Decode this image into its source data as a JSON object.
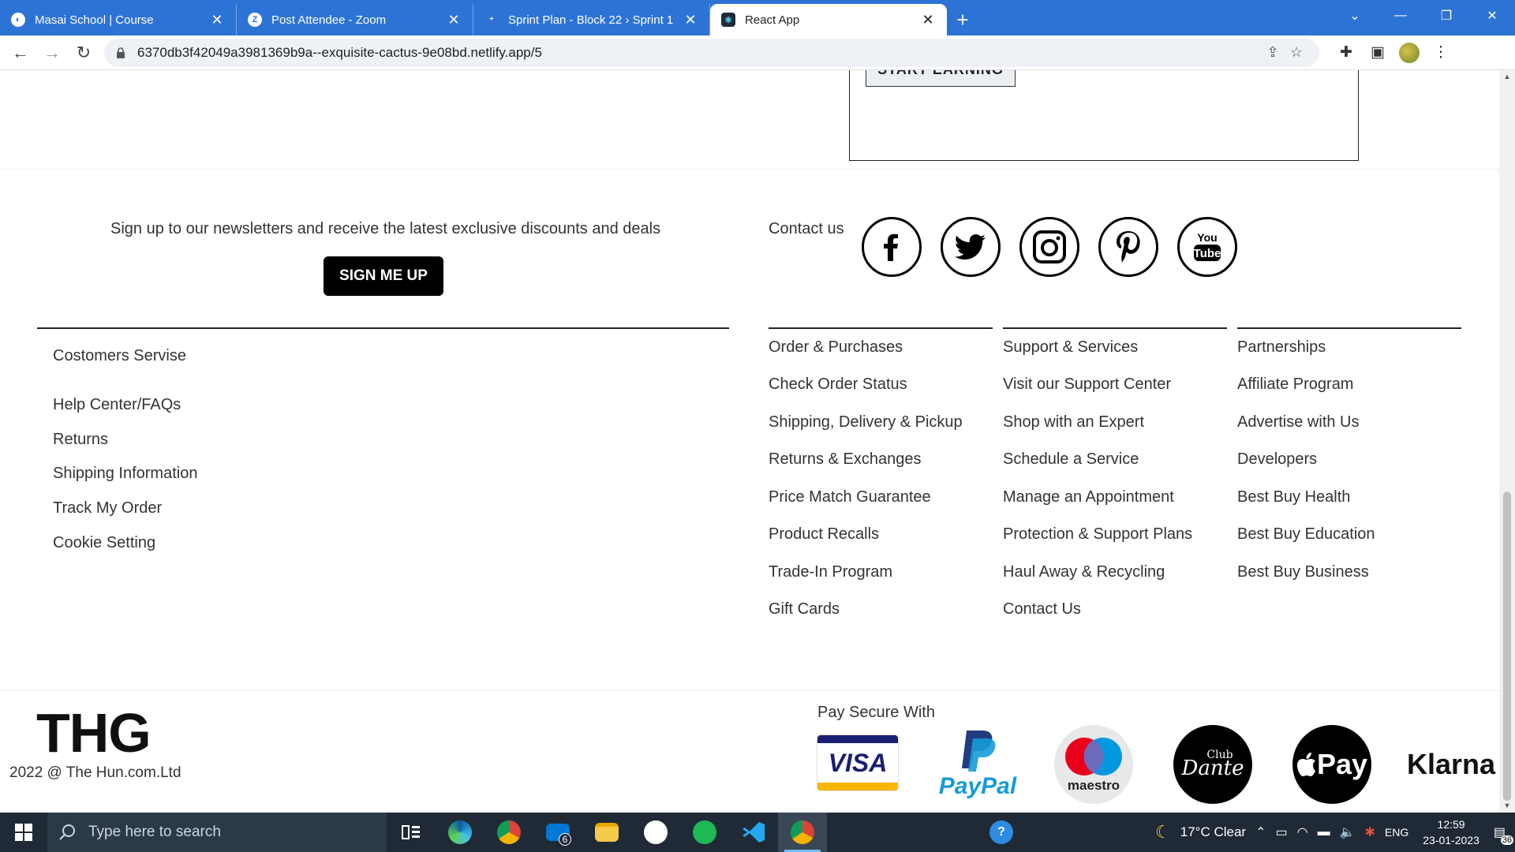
{
  "browser": {
    "tabs": [
      {
        "title": "Masai School | Course",
        "active": false
      },
      {
        "title": "Post Attendee - Zoom",
        "active": false
      },
      {
        "title": "Sprint Plan - Block 22 › Sprint 1",
        "active": false
      },
      {
        "title": "React App",
        "active": true
      }
    ],
    "close_glyph": "✕",
    "new_tab_glyph": "+",
    "url": "6370db3f42049a3981369b9a--exquisite-cactus-9e08bd.netlify.app/5"
  },
  "page": {
    "promo_button": "START EARNING",
    "newsletter": {
      "text": "Sign up to our newsletters and receive the latest exclusive discounts and deals",
      "button": "SIGN ME UP"
    },
    "contact": {
      "label": "Contact us",
      "socials": [
        "facebook-icon",
        "twitter-icon",
        "instagram-icon",
        "pinterest-icon",
        "youtube-icon"
      ]
    },
    "customer_service": {
      "title": "Costomers Servise",
      "links": [
        "Help Center/FAQs",
        "Returns",
        "Shipping Information",
        "Track My Order",
        "Cookie Setting"
      ]
    },
    "columns": [
      {
        "title": "Order & Purchases",
        "links": [
          "Check Order Status",
          "Shipping, Delivery & Pickup",
          "Returns & Exchanges",
          "Price Match Guarantee",
          "Product Recalls",
          "Trade-In Program",
          "Gift Cards"
        ]
      },
      {
        "title": "Support & Services",
        "links": [
          "Visit our Support Center",
          "Shop with an Expert",
          "Schedule a Service",
          "Manage an Appointment",
          "Protection & Support Plans",
          "Haul Away & Recycling",
          "Contact Us"
        ]
      },
      {
        "title": "Partnerships",
        "links": [
          "Affiliate Program",
          "Advertise with Us",
          "Developers",
          "Best Buy Health",
          "Best Buy Education",
          "Best Buy Business"
        ]
      }
    ],
    "brand": "THG",
    "copyright": "2022 @ The Hun.com.Ltd",
    "payments": {
      "label": "Pay Secure With",
      "visa": "VISA",
      "paypal": "PayPal",
      "maestro": "maestro",
      "dante_top": "Club",
      "dante_main": "Dante",
      "applepay": "Pay",
      "klarna": "Klarna"
    }
  },
  "taskbar": {
    "search_placeholder": "Type here to search",
    "mail_badge": "6",
    "weather": "17°C  Clear",
    "language": "ENG",
    "time": "12:59",
    "date": "23-01-2023",
    "notifications": "36"
  },
  "colors": {
    "tabbar": "#2d73d6",
    "taskbar": "#1f2a36",
    "button_dark": "#000000"
  }
}
